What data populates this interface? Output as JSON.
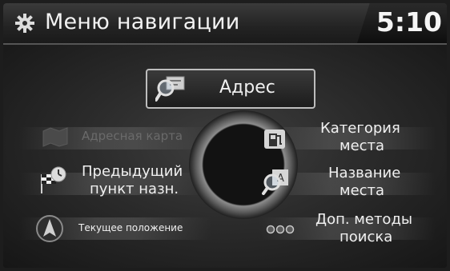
{
  "header": {
    "title": "Меню навигации",
    "clock": "5:10"
  },
  "menu": {
    "address": "Адрес",
    "address_map": "Адресная карта",
    "previous_destination_line1": "Предыдущий",
    "previous_destination_line2": "пункт назн.",
    "current_position": "Текущее положение",
    "place_category_line1": "Категория",
    "place_category_line2": "места",
    "place_name_line1": "Название",
    "place_name_line2": "места",
    "more_methods_line1": "Доп. методы",
    "more_methods_line2": "поиска"
  },
  "icons": {
    "header": "gear-icon",
    "address": "magnifier-card-icon",
    "address_map": "map-icon",
    "previous_destination": "flag-clock-icon",
    "current_position": "compass-arrow-icon",
    "place_category": "fuel-pump-icon",
    "place_name": "magnifier-letter-icon",
    "more_methods": "three-dots-icon"
  },
  "colors": {
    "text": "#f0f0f0",
    "disabled_text": "#6a6a6a",
    "background": "#101010"
  }
}
